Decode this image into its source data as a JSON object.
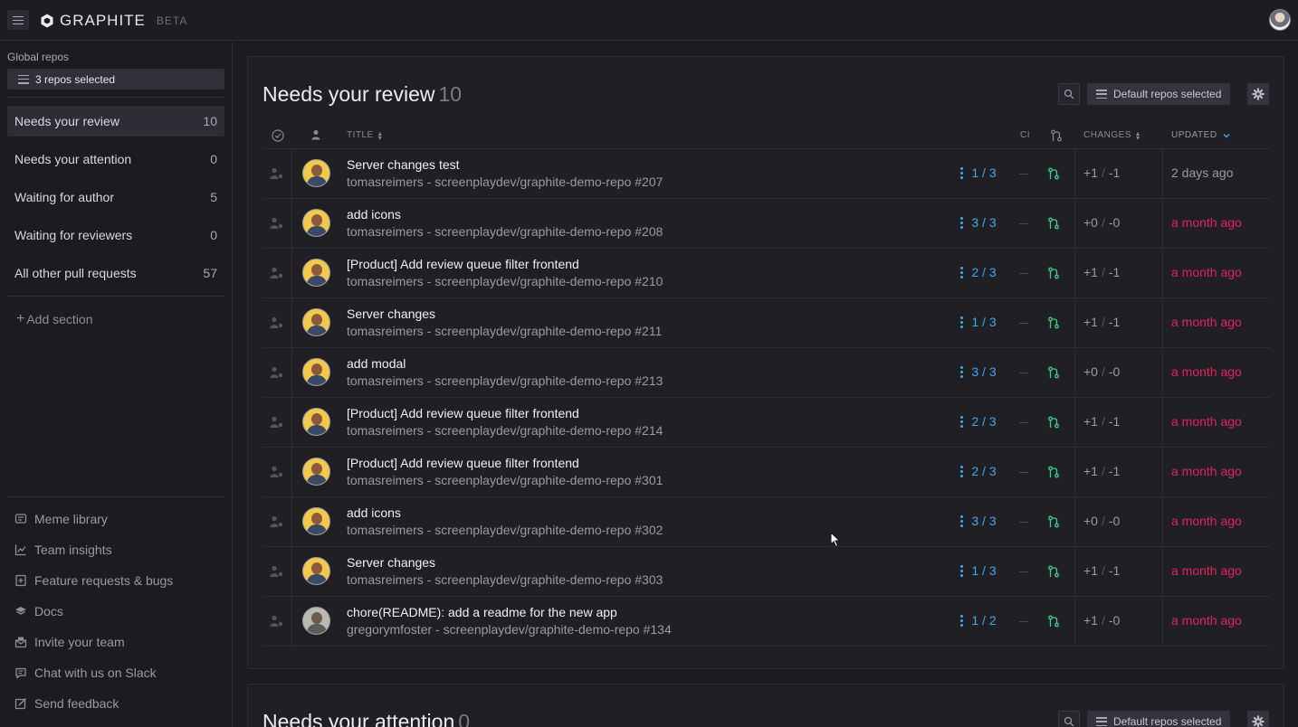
{
  "app": {
    "name": "GRAPHITE",
    "beta": "BETA"
  },
  "sidebar": {
    "global_label": "Global repos",
    "repo_select": "3 repos selected",
    "sections": [
      {
        "label": "Needs your review",
        "count": "10"
      },
      {
        "label": "Needs your attention",
        "count": "0"
      },
      {
        "label": "Waiting for author",
        "count": "5"
      },
      {
        "label": "Waiting for reviewers",
        "count": "0"
      },
      {
        "label": "All other pull requests",
        "count": "57"
      }
    ],
    "add_section": "Add section",
    "links": [
      {
        "label": "Meme library",
        "icon": "meme-icon"
      },
      {
        "label": "Team insights",
        "icon": "chart-icon"
      },
      {
        "label": "Feature requests & bugs",
        "icon": "request-icon"
      },
      {
        "label": "Docs",
        "icon": "book-icon"
      },
      {
        "label": "Invite your team",
        "icon": "invite-icon"
      },
      {
        "label": "Chat with us on Slack",
        "icon": "chat-icon"
      },
      {
        "label": "Send feedback",
        "icon": "edit-icon"
      }
    ]
  },
  "review_panel": {
    "title": "Needs your review",
    "count": "10",
    "repo_filter": "Default repos selected",
    "columns": {
      "title": "TITLE",
      "ci": "CI",
      "changes": "CHANGES",
      "updated": "UPDATED"
    },
    "rows": [
      {
        "title": "Server changes test",
        "subtitle": "tomasreimers - screenplaydev/graphite-demo-repo #207",
        "reviews": "1 / 3",
        "add": "+1",
        "del": "-1",
        "updated": "2 days ago",
        "stale": false
      },
      {
        "title": "add icons",
        "subtitle": "tomasreimers - screenplaydev/graphite-demo-repo #208",
        "reviews": "3 / 3",
        "add": "+0",
        "del": "-0",
        "updated": "a month ago",
        "stale": true
      },
      {
        "title": "[Product] Add review queue filter frontend",
        "subtitle": "tomasreimers - screenplaydev/graphite-demo-repo #210",
        "reviews": "2 / 3",
        "add": "+1",
        "del": "-1",
        "updated": "a month ago",
        "stale": true
      },
      {
        "title": "Server changes",
        "subtitle": "tomasreimers - screenplaydev/graphite-demo-repo #211",
        "reviews": "1 / 3",
        "add": "+1",
        "del": "-1",
        "updated": "a month ago",
        "stale": true
      },
      {
        "title": "add modal",
        "subtitle": "tomasreimers - screenplaydev/graphite-demo-repo #213",
        "reviews": "3 / 3",
        "add": "+0",
        "del": "-0",
        "updated": "a month ago",
        "stale": true
      },
      {
        "title": "[Product] Add review queue filter frontend",
        "subtitle": "tomasreimers - screenplaydev/graphite-demo-repo #214",
        "reviews": "2 / 3",
        "add": "+1",
        "del": "-1",
        "updated": "a month ago",
        "stale": true
      },
      {
        "title": "[Product] Add review queue filter frontend",
        "subtitle": "tomasreimers - screenplaydev/graphite-demo-repo #301",
        "reviews": "2 / 3",
        "add": "+1",
        "del": "-1",
        "updated": "a month ago",
        "stale": true
      },
      {
        "title": "add icons",
        "subtitle": "tomasreimers - screenplaydev/graphite-demo-repo #302",
        "reviews": "3 / 3",
        "add": "+0",
        "del": "-0",
        "updated": "a month ago",
        "stale": true
      },
      {
        "title": "Server changes",
        "subtitle": "tomasreimers - screenplaydev/graphite-demo-repo #303",
        "reviews": "1 / 3",
        "add": "+1",
        "del": "-1",
        "updated": "a month ago",
        "stale": true
      },
      {
        "title": "chore(README): add a readme for the new app",
        "subtitle": "gregorymfoster - screenplaydev/graphite-demo-repo #134",
        "reviews": "1 / 2",
        "add": "+1",
        "del": "-0",
        "updated": "a month ago",
        "stale": true
      }
    ]
  },
  "attention_panel": {
    "title": "Needs your attention",
    "count": "0",
    "repo_filter": "Default repos selected"
  },
  "colors": {
    "accent_blue": "#3fa9f5",
    "stale_red": "#e0245e",
    "merge_green": "#3ecf8e"
  }
}
